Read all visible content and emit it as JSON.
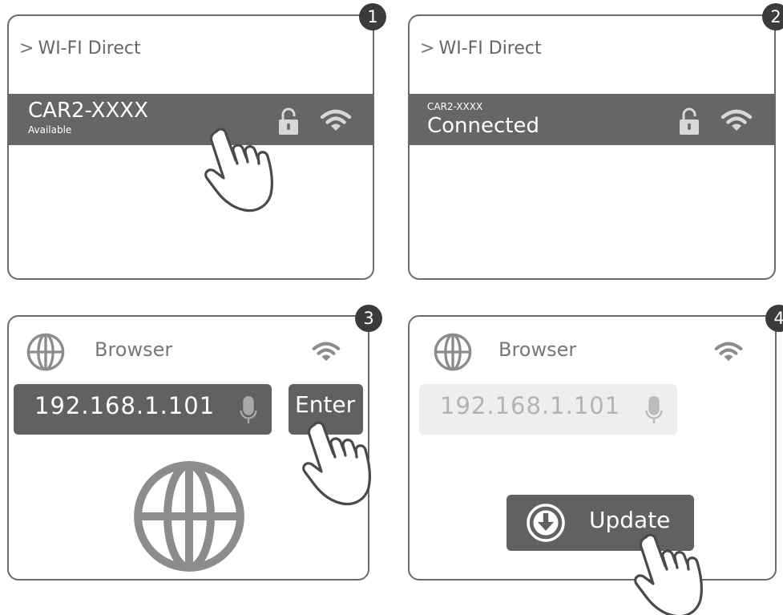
{
  "steps": [
    "1",
    "2",
    "3",
    "4"
  ],
  "panel1": {
    "breadcrumb": "WI-FI Direct",
    "network_name": "CAR2-XXXX",
    "network_status": "Available"
  },
  "panel2": {
    "breadcrumb": "WI-FI Direct",
    "network_name": "CAR2-XXXX",
    "network_status": "Connected"
  },
  "panel3": {
    "app_title": "Browser",
    "url_value": "192.168.1.101",
    "enter_label": "Enter"
  },
  "panel4": {
    "app_title": "Browser",
    "url_value": "192.168.1.101",
    "update_label": "Update"
  },
  "colors": {
    "bar": "#666666",
    "badge": "#3b3b3b",
    "border": "#6b6b6b",
    "icon": "#8c8c8c",
    "disabled_field": "#eeeeee"
  },
  "icons": [
    "chevron-right-icon",
    "lock-icon",
    "wifi-icon",
    "globe-icon",
    "microphone-icon",
    "download-icon",
    "pointing-hand-icon"
  ]
}
